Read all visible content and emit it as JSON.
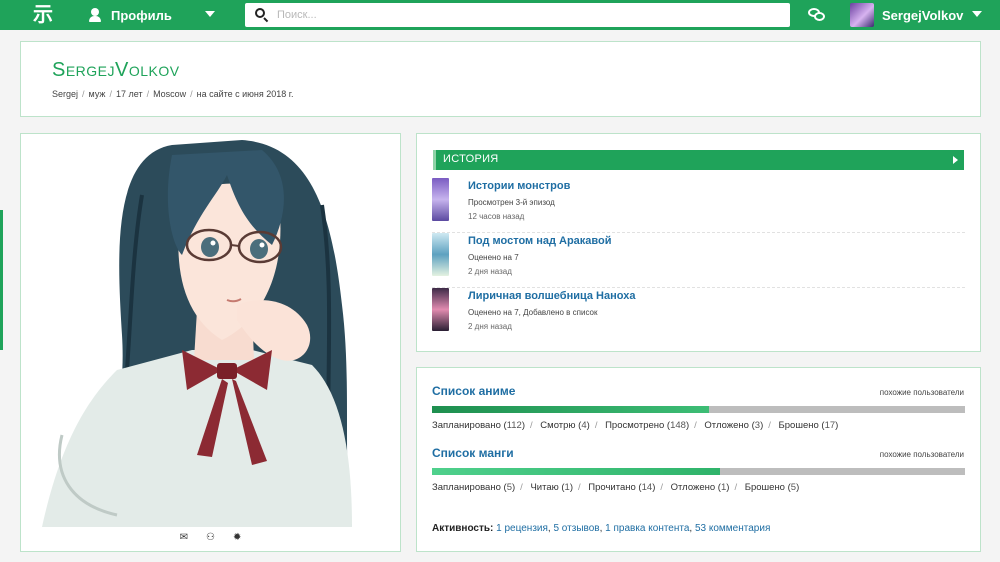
{
  "topbar": {
    "logo_text": "示",
    "profile_label": "Профиль",
    "search_placeholder": "Поиск...",
    "username": "SergejVolkov",
    "colors": {
      "bar": "#1fa35a"
    }
  },
  "header": {
    "title": "SergejVolkov",
    "meta": [
      "Sergej",
      "муж",
      "17 лет",
      "Moscow",
      "на сайте с июня 2018 г."
    ]
  },
  "history": {
    "heading": "ИСТОРИЯ",
    "items": [
      {
        "title": "Истории монстров",
        "desc": "Просмотрен 3-й эпизод",
        "time": "12 часов назад"
      },
      {
        "title": "Под мостом над Аракавой",
        "desc": "Оценено на 7",
        "time": "2 дня назад"
      },
      {
        "title": "Лиричная волшебница Наноха",
        "desc": "Оценено на 7, Добавлено в список",
        "time": "2 дня назад"
      }
    ]
  },
  "anime_list": {
    "title": "Список аниме",
    "similar": "похожие пользователи",
    "progress_fraction": 0.52,
    "stats": [
      {
        "label": "Запланировано",
        "value": "112"
      },
      {
        "label": "Смотрю",
        "value": "4"
      },
      {
        "label": "Просмотрено",
        "value": "148"
      },
      {
        "label": "Отложено",
        "value": "3"
      },
      {
        "label": "Брошено",
        "value": "17"
      }
    ]
  },
  "manga_list": {
    "title": "Список манги",
    "similar": "похожие пользователи",
    "progress_fraction": 0.54,
    "stats": [
      {
        "label": "Запланировано",
        "value": "5"
      },
      {
        "label": "Читаю",
        "value": "1"
      },
      {
        "label": "Прочитано",
        "value": "14"
      },
      {
        "label": "Отложено",
        "value": "1"
      },
      {
        "label": "Брошено",
        "value": "5"
      }
    ]
  },
  "activity": {
    "label": "Активность:",
    "links": [
      "1 рецензия",
      "5 отзывов",
      "1 правка контента",
      "53 комментария"
    ]
  }
}
